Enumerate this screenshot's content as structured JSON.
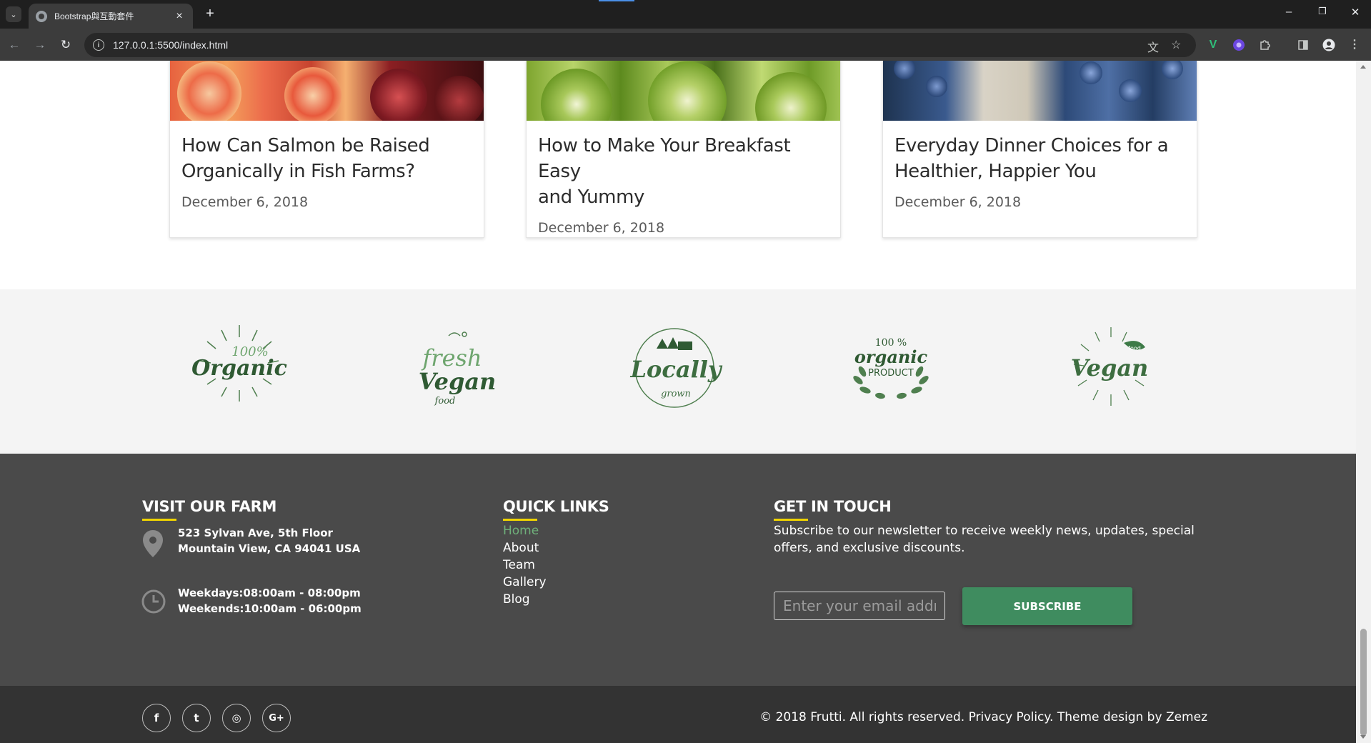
{
  "browser": {
    "tab_title": "Bootstrap與互動套件",
    "url": "127.0.0.1:5500/index.html"
  },
  "blog": {
    "cards": [
      {
        "title_line1": "How Can Salmon be Raised",
        "title_line2": "Organically in Fish Farms?",
        "date": "December 6, 2018"
      },
      {
        "title_line1": "How to Make Your Breakfast Easy",
        "title_line2": "and Yummy",
        "date": "December 6, 2018"
      },
      {
        "title_line1": "Everyday Dinner Choices for a",
        "title_line2": "Healthier, Happier You",
        "date": "December 6, 2018"
      }
    ]
  },
  "badges": [
    {
      "top": "100%",
      "main": "Organic"
    },
    {
      "top": "fresh",
      "main": "Vegan",
      "sub": "food"
    },
    {
      "main": "Locally",
      "sub": "grown"
    },
    {
      "top": "100 %",
      "main": "organic",
      "sub": "PRODUCT"
    },
    {
      "top": "food",
      "main": "Vegan"
    }
  ],
  "footer": {
    "visit": {
      "heading": "VISIT OUR FARM",
      "address_line1": "523 Sylvan Ave, 5th Floor",
      "address_line2": "Mountain View, CA 94041 USA",
      "hours_line1": "Weekdays:08:00am - 08:00pm",
      "hours_line2": "Weekends:10:00am - 06:00pm"
    },
    "links": {
      "heading": "QUICK LINKS",
      "items": [
        "Home",
        "About",
        "Team",
        "Gallery",
        "Blog"
      ]
    },
    "contact": {
      "heading": "GET IN TOUCH",
      "text": "Subscribe to our newsletter to receive weekly news, updates, special offers, and exclusive discounts.",
      "email_placeholder": "Enter your email address",
      "subscribe_label": "SUBSCRIBE"
    },
    "social": {
      "facebook": "f",
      "twitter": "t",
      "instagram": "◎",
      "googleplus": "G+"
    },
    "copyright": "© 2018 Frutti. All rights reserved. Privacy Policy. Theme design by Zemez"
  },
  "colors": {
    "accent_green": "#3f8c5f",
    "active_link": "#6fb07a",
    "heading_underline": "#f0d400",
    "footer_bg": "#4a4a4a",
    "bottom_bar_bg": "#333333"
  }
}
